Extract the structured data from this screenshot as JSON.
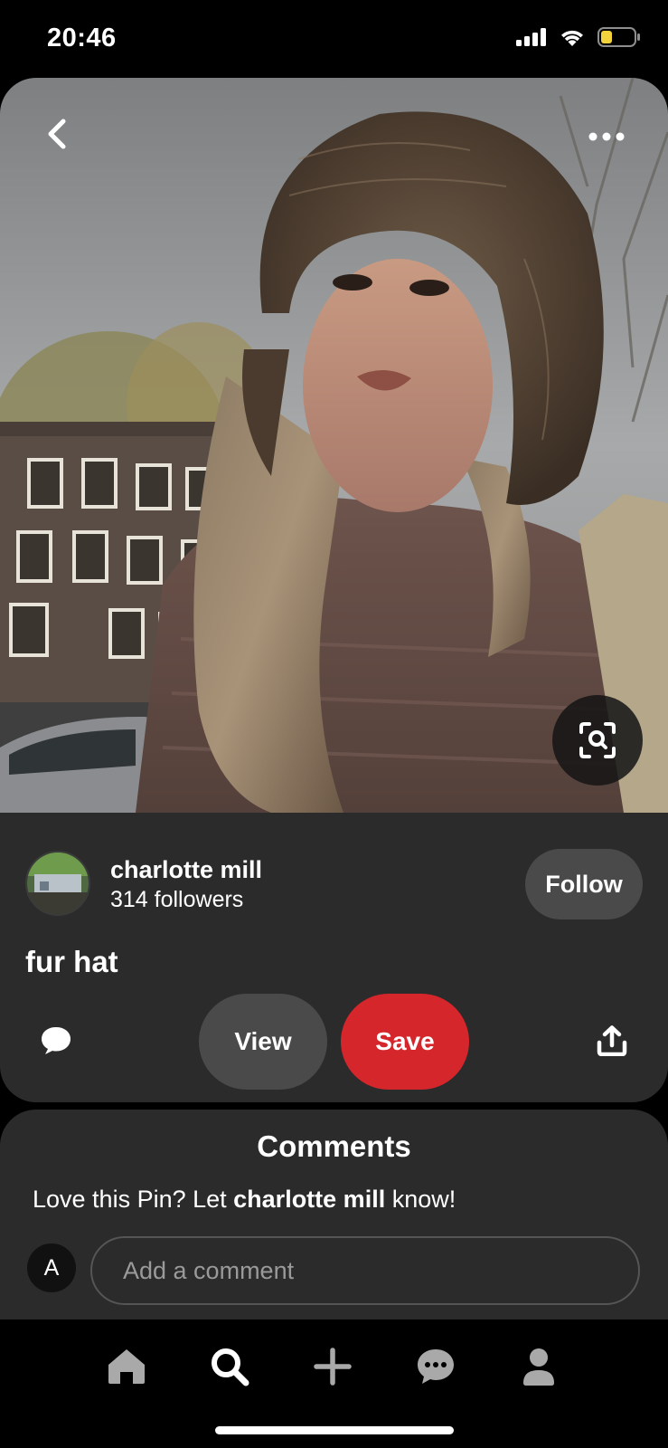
{
  "status_bar": {
    "time": "20:46",
    "battery_color": "#f3d33c"
  },
  "pin": {
    "title": "fur hat",
    "creator": {
      "name": "charlotte mill",
      "followers": "314 followers"
    },
    "follow_label": "Follow",
    "view_label": "View",
    "save_label": "Save",
    "save_color": "#d5262c"
  },
  "comments": {
    "title": "Comments",
    "prompt_prefix": "Love this Pin? Let ",
    "prompt_name": "charlotte mill",
    "prompt_suffix": " know!",
    "user_initial": "A",
    "input_placeholder": "Add a comment"
  },
  "nav": {
    "items": [
      "home-icon",
      "search-icon",
      "plus-icon",
      "chat-icon",
      "profile-icon"
    ],
    "active": "search-icon"
  }
}
